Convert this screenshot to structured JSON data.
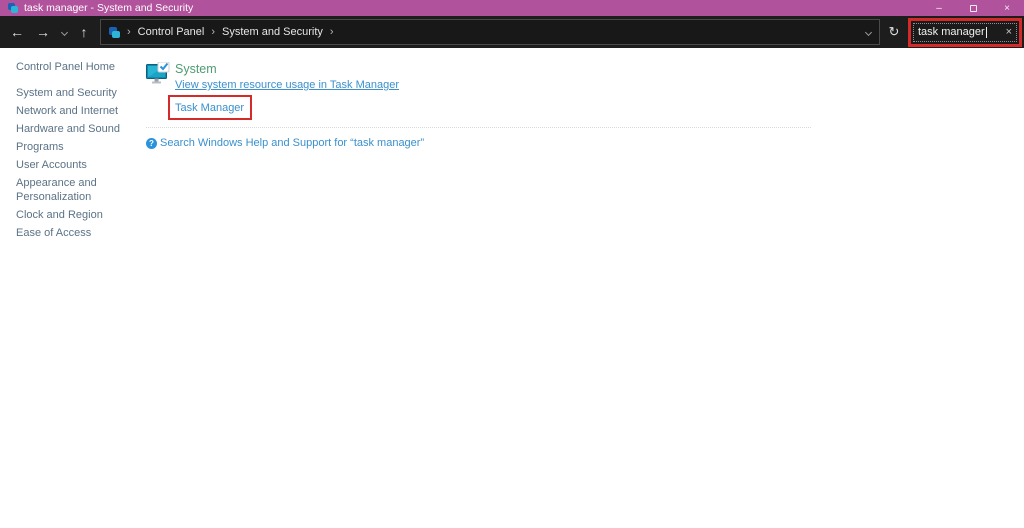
{
  "window": {
    "title": "task manager - System and Security",
    "controls": {
      "minimize": "–",
      "close": "×"
    }
  },
  "navbar": {
    "back_icon": "←",
    "forward_icon": "→",
    "up_icon": "↑",
    "refresh_icon": "↻",
    "breadcrumb": {
      "separator": "›",
      "items": [
        "Control Panel",
        "System and Security"
      ]
    },
    "search": {
      "value": "task manager",
      "clear_icon": "×"
    }
  },
  "sidebar": {
    "home": "Control Panel Home",
    "items": [
      "System and Security",
      "Network and Internet",
      "Hardware and Sound",
      "Programs",
      "User Accounts",
      "Appearance and Personalization",
      "Clock and Region",
      "Ease of Access"
    ]
  },
  "main": {
    "section": {
      "title": "System",
      "links": {
        "resource_usage": "View system resource usage in Task Manager",
        "task_manager": "Task Manager"
      }
    },
    "help_icon": "?",
    "help_link": "Search Windows Help and Support for “task manager”"
  },
  "colors": {
    "titlebar": "#b1529c",
    "navbar_bg": "#1d1d1d",
    "annotation_red": "#d42a2a",
    "link_blue": "#3a90cc",
    "heading_green": "#4f9b73",
    "sidebar_link": "#5b7386",
    "content_bg": "#ffffff"
  }
}
